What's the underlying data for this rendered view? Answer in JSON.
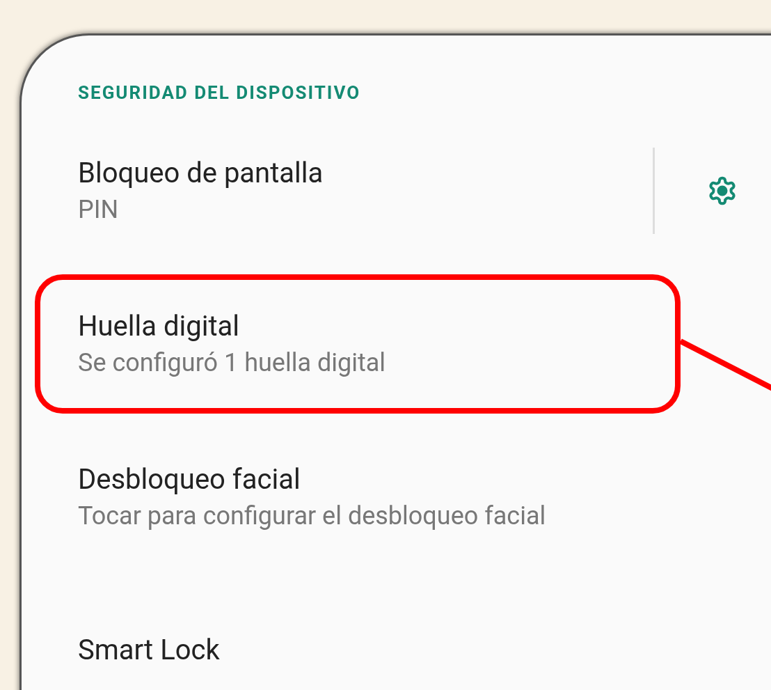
{
  "section_header": "SEGURIDAD DEL DISPOSITIVO",
  "items": [
    {
      "title": "Bloqueo de pantalla",
      "subtitle": "PIN",
      "has_settings": true,
      "highlighted": false
    },
    {
      "title": "Huella digital",
      "subtitle": "Se configuró 1 huella digital",
      "has_settings": false,
      "highlighted": true
    },
    {
      "title": "Desbloqueo facial",
      "subtitle": "Tocar para configurar el desbloqueo facial",
      "has_settings": false,
      "highlighted": false
    },
    {
      "title": "Smart Lock",
      "has_settings": false,
      "highlighted": false
    }
  ]
}
